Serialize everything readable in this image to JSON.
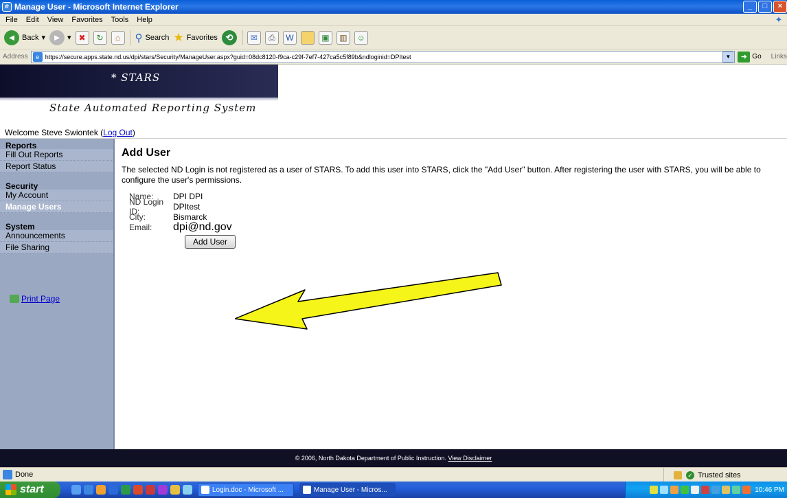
{
  "window": {
    "title": "Manage User - Microsoft Internet Explorer",
    "min_label": "_",
    "max_label": "□",
    "close_label": "×"
  },
  "menu": [
    "File",
    "Edit",
    "View",
    "Favorites",
    "Tools",
    "Help"
  ],
  "toolbar": {
    "back_label": "Back",
    "search_label": "Search",
    "favorites_label": "Favorites"
  },
  "address": {
    "label": "Address",
    "url": "https://secure.apps.state.nd.us/dpi/stars/Security/ManageUser.aspx?guid=08dc8120-f9ca-c29f-7ef7-427ca5c5f89b&ndloginid=DPItest",
    "go_label": "Go",
    "links_label": "Links"
  },
  "banner": {
    "name": "* STARS",
    "subtitle": "State Automated Reporting System"
  },
  "welcome": {
    "text": "Welcome Steve Swiontek (",
    "logout": "Log Out",
    "close_paren": ")"
  },
  "sidebar": {
    "sections": [
      {
        "heading": "Reports",
        "items": [
          {
            "label": "Fill Out Reports",
            "active": false
          },
          {
            "label": "Report Status",
            "active": false
          }
        ]
      },
      {
        "heading": "Security",
        "items": [
          {
            "label": "My Account",
            "active": false
          },
          {
            "label": "Manage Users",
            "active": true
          }
        ]
      },
      {
        "heading": "System",
        "items": [
          {
            "label": "Announcements",
            "active": false
          },
          {
            "label": "File Sharing",
            "active": false
          }
        ]
      }
    ],
    "print_label": "Print Page"
  },
  "main": {
    "title": "Add User",
    "message": "The selected ND Login is not registered as a user of STARS. To add this user into STARS, click the \"Add User\" button. After registering the user with STARS, you will be able to configure the user's permissions.",
    "fields": {
      "name_key": "Name:",
      "name_val": "DPI DPI",
      "login_key": "ND Login ID:",
      "login_val": "DPItest",
      "city_key": "City:",
      "city_val": "Bismarck",
      "email_key": "Email:",
      "email_val": "dpi@nd.gov"
    },
    "add_button": "Add User"
  },
  "footer": {
    "text": "© 2006, North Dakota Department of Public Instruction.",
    "link": "View Disclaimer"
  },
  "status": {
    "text": "Done",
    "zone": "Trusted sites"
  },
  "taskbar": {
    "start": "start",
    "tasks": [
      "Login.doc - Microsoft ...",
      "Manage User - Micros..."
    ],
    "clock": "10:46 PM"
  },
  "colors": {
    "sidebar": "#9aa8c2",
    "footer": "#101025",
    "arrow": "#f5f51a"
  }
}
